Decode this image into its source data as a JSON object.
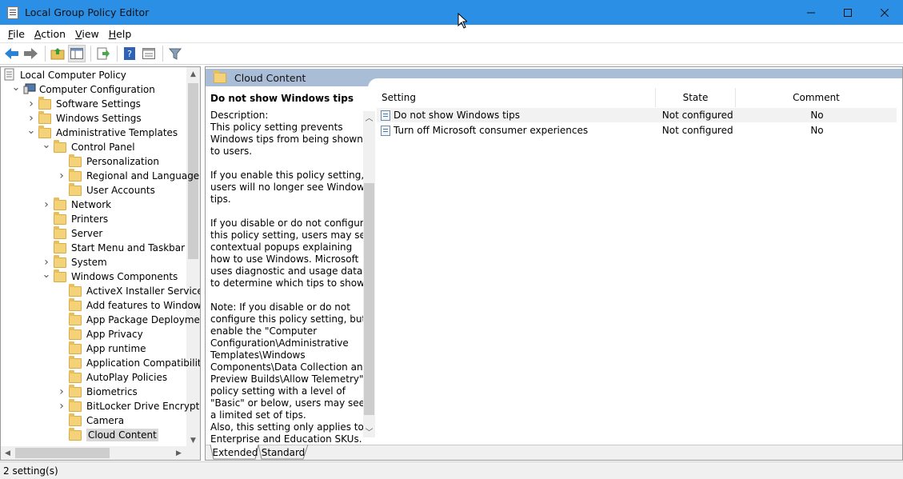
{
  "window": {
    "title": "Local Group Policy Editor"
  },
  "menu": [
    {
      "label": "File",
      "key": "F",
      "rest": "ile"
    },
    {
      "label": "Action",
      "key": "A",
      "rest": "ction"
    },
    {
      "label": "View",
      "key": "V",
      "rest": "iew"
    },
    {
      "label": "Help",
      "key": "H",
      "rest": "elp"
    }
  ],
  "toolbar": [
    "back-icon",
    "forward-icon",
    "up-folder-icon",
    "show-hide-tree-icon",
    "export-list-icon",
    "help-icon",
    "properties-icon",
    "filter-icon"
  ],
  "tree": [
    {
      "label": "Local Computer Policy",
      "level": 0,
      "expander": "",
      "icon": "policy"
    },
    {
      "label": "Computer Configuration",
      "level": 0,
      "expander": "open",
      "icon": "computer"
    },
    {
      "label": "Software Settings",
      "level": 1,
      "expander": "closed",
      "icon": "folder"
    },
    {
      "label": "Windows Settings",
      "level": 1,
      "expander": "closed",
      "icon": "folder"
    },
    {
      "label": "Administrative Templates",
      "level": 1,
      "expander": "open",
      "icon": "folder"
    },
    {
      "label": "Control Panel",
      "level": 2,
      "expander": "open",
      "icon": "folder"
    },
    {
      "label": "Personalization",
      "level": 3,
      "expander": "",
      "icon": "folder"
    },
    {
      "label": "Regional and Language O",
      "level": 3,
      "expander": "closed",
      "icon": "folder"
    },
    {
      "label": "User Accounts",
      "level": 3,
      "expander": "",
      "icon": "folder"
    },
    {
      "label": "Network",
      "level": 2,
      "expander": "closed",
      "icon": "folder"
    },
    {
      "label": "Printers",
      "level": 2,
      "expander": "",
      "icon": "folder"
    },
    {
      "label": "Server",
      "level": 2,
      "expander": "",
      "icon": "folder"
    },
    {
      "label": "Start Menu and Taskbar",
      "level": 2,
      "expander": "",
      "icon": "folder"
    },
    {
      "label": "System",
      "level": 2,
      "expander": "closed",
      "icon": "folder"
    },
    {
      "label": "Windows Components",
      "level": 2,
      "expander": "open",
      "icon": "folder"
    },
    {
      "label": "ActiveX Installer Service",
      "level": 3,
      "expander": "",
      "icon": "folder"
    },
    {
      "label": "Add features to Windows",
      "level": 3,
      "expander": "",
      "icon": "folder"
    },
    {
      "label": "App Package Deploymen",
      "level": 3,
      "expander": "",
      "icon": "folder"
    },
    {
      "label": "App Privacy",
      "level": 3,
      "expander": "",
      "icon": "folder"
    },
    {
      "label": "App runtime",
      "level": 3,
      "expander": "",
      "icon": "folder"
    },
    {
      "label": "Application Compatibilit",
      "level": 3,
      "expander": "",
      "icon": "folder"
    },
    {
      "label": "AutoPlay Policies",
      "level": 3,
      "expander": "",
      "icon": "folder"
    },
    {
      "label": "Biometrics",
      "level": 3,
      "expander": "closed",
      "icon": "folder"
    },
    {
      "label": "BitLocker Drive Encryptio",
      "level": 3,
      "expander": "closed",
      "icon": "folder"
    },
    {
      "label": "Camera",
      "level": 3,
      "expander": "",
      "icon": "folder"
    },
    {
      "label": "Cloud Content",
      "level": 3,
      "expander": "",
      "icon": "folder",
      "selected": true
    }
  ],
  "path_header": "Cloud Content",
  "description": {
    "title": "Do not show Windows tips",
    "paragraphs": [
      "Description:\nThis policy setting prevents Windows tips from being shown to users.",
      "If you enable this policy setting, users will no longer see Windows tips.",
      "If you disable or do not configure this policy setting, users may see contextual popups explaining how to use Windows. Microsoft uses diagnostic and usage data to determine which tips to show.",
      "Note: If you disable or do not configure this policy setting, but enable the \"Computer Configuration\\Administrative Templates\\Windows Components\\Data Collection and Preview Builds\\Allow Telemetry\" policy setting with a level of \"Basic\" or below, users may see a limited set of tips.\nAlso, this setting only applies to Enterprise and Education SKUs."
    ]
  },
  "columns": {
    "setting": "Setting",
    "state": "State",
    "comment": "Comment"
  },
  "rows": [
    {
      "setting": "Do not show Windows tips",
      "state": "Not configured",
      "comment": "No"
    },
    {
      "setting": "Turn off Microsoft consumer experiences",
      "state": "Not configured",
      "comment": "No"
    }
  ],
  "tabs": {
    "extended": "Extended",
    "standard": "Standard"
  },
  "status": "2 setting(s)"
}
